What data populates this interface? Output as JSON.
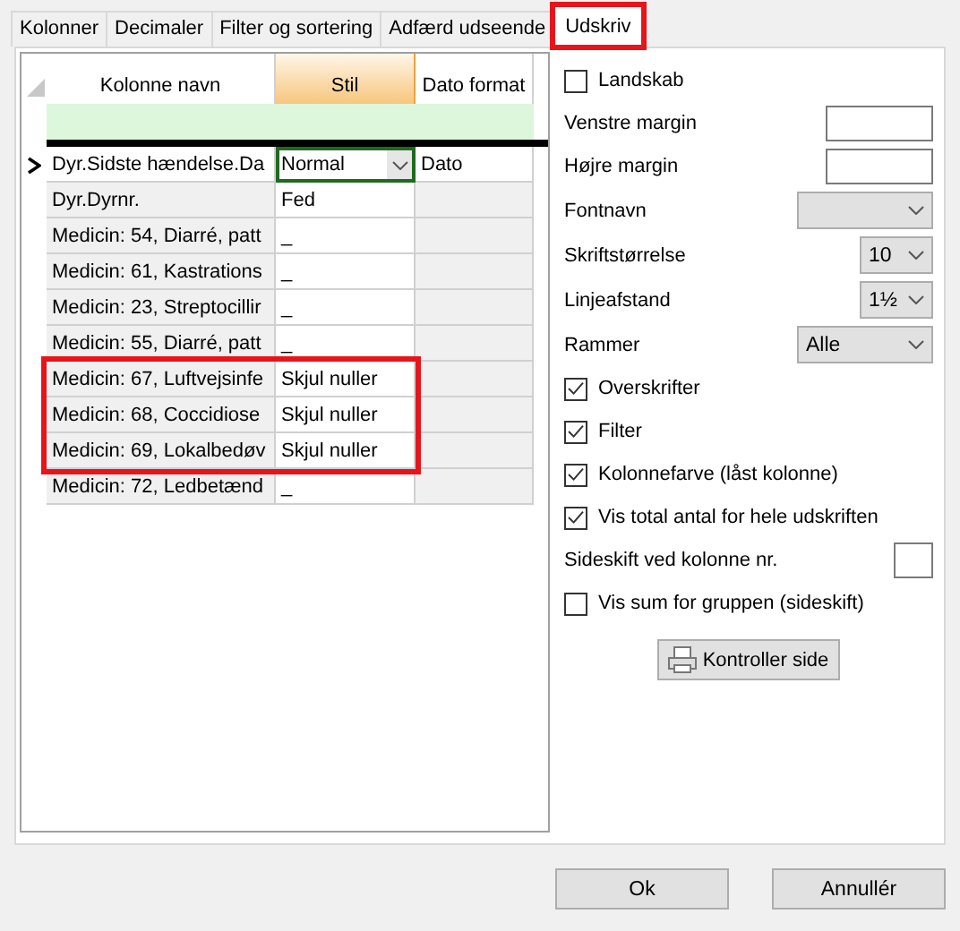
{
  "tabs": [
    {
      "label": "Kolonner",
      "selected": false,
      "highlighted": false
    },
    {
      "label": "Decimaler",
      "selected": false,
      "highlighted": false
    },
    {
      "label": "Filter og sortering",
      "selected": false,
      "highlighted": false
    },
    {
      "label": "Adfærd  udseende",
      "selected": false,
      "highlighted": false
    },
    {
      "label": "Udskriv",
      "selected": true,
      "highlighted": true
    }
  ],
  "grid": {
    "columns": [
      {
        "label": "Kolonne navn",
        "selected": false
      },
      {
        "label": "Stil",
        "selected": true
      },
      {
        "label": "Dato format",
        "selected": false
      }
    ],
    "rows": [
      {
        "name": "Dyr.Sidste hændelse.Da",
        "style": "Normal",
        "date_format": "Dato",
        "current": true,
        "highlighted": false
      },
      {
        "name": "Dyr.Dyrnr.",
        "style": "Fed",
        "current": false,
        "highlighted": false
      },
      {
        "name": "Medicin: 54, Diarré, patt",
        "style": "_",
        "current": false,
        "highlighted": false
      },
      {
        "name": "Medicin: 61, Kastrations",
        "style": "_",
        "current": false,
        "highlighted": false
      },
      {
        "name": "Medicin: 23, Streptocillir",
        "style": "_",
        "current": false,
        "highlighted": false
      },
      {
        "name": "Medicin: 55, Diarré, patt",
        "style": "_",
        "current": false,
        "highlighted": false
      },
      {
        "name": "Medicin: 67, Luftvejsinfe",
        "style": "Skjul nuller",
        "current": false,
        "highlighted": true
      },
      {
        "name": "Medicin: 68, Coccidiose",
        "style": "Skjul nuller",
        "current": false,
        "highlighted": true
      },
      {
        "name": "Medicin: 69, Lokalbedøv",
        "style": "Skjul nuller",
        "current": false,
        "highlighted": true
      },
      {
        "name": "Medicin: 72, Ledbetænd",
        "style": "_",
        "current": false,
        "highlighted": false
      }
    ]
  },
  "print_options": [
    {
      "kind": "checkbox",
      "label": "Landskab",
      "checked": false
    },
    {
      "kind": "input",
      "label": "Venstre margin"
    },
    {
      "kind": "input",
      "label": "Højre margin"
    },
    {
      "kind": "dropdown",
      "label": "Fontnavn"
    },
    {
      "kind": "number_dropdown",
      "label": "Skriftstørrelse",
      "value": "10"
    },
    {
      "kind": "number_dropdown",
      "label": "Linjeafstand",
      "value": "1½"
    },
    {
      "kind": "dropdown",
      "label": "Rammer",
      "value": "Alle"
    },
    {
      "kind": "checkbox",
      "label": "Overskrifter",
      "checked": true
    },
    {
      "kind": "checkbox",
      "label": "Filter",
      "checked": true
    },
    {
      "kind": "checkbox",
      "label": "Kolonnefarve (låst kolonne)",
      "checked": true
    },
    {
      "kind": "checkbox",
      "label": "Vis total antal for hele udskriften",
      "checked": true
    },
    {
      "kind": "number_input",
      "label": "Sideskift ved kolonne nr."
    },
    {
      "kind": "checkbox",
      "label": "Vis sum for gruppen (sideskift)",
      "checked": false
    },
    {
      "kind": "button",
      "label": "Kontroller side"
    }
  ],
  "buttons": [
    "Ok",
    "Annullér"
  ]
}
